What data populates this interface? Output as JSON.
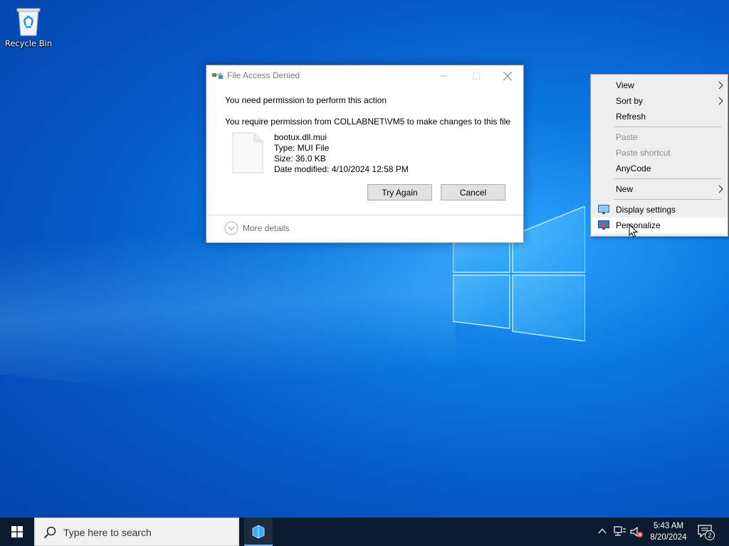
{
  "desktop": {
    "icons": [
      {
        "label": "Recycle Bin",
        "icon": "recycle-bin-icon"
      }
    ]
  },
  "dialog": {
    "title": "File Access Denied",
    "heading": "You need permission to perform this action",
    "message": "You require permission from COLLABNET\\VM5 to make changes to this file",
    "file": {
      "name": "bootux.dll.mui",
      "type": "Type: MUI File",
      "size": "Size: 36.0 KB",
      "modified": "Date modified: 4/10/2024 12:58 PM"
    },
    "buttons": {
      "try_again": "Try Again",
      "cancel": "Cancel"
    },
    "more_details": "More details"
  },
  "context_menu": {
    "items": [
      {
        "label": "View",
        "submenu": true,
        "enabled": true
      },
      {
        "label": "Sort by",
        "submenu": true,
        "enabled": true
      },
      {
        "label": "Refresh",
        "submenu": false,
        "enabled": true
      },
      {
        "label": "Paste",
        "submenu": false,
        "enabled": false
      },
      {
        "label": "Paste shortcut",
        "submenu": false,
        "enabled": false
      },
      {
        "label": "AnyCode",
        "submenu": false,
        "enabled": true
      },
      {
        "label": "New",
        "submenu": true,
        "enabled": true
      },
      {
        "label": "Display settings",
        "submenu": false,
        "enabled": true,
        "icon": "display-settings-icon"
      },
      {
        "label": "Personalize",
        "submenu": false,
        "enabled": true,
        "icon": "personalize-icon",
        "highlighted": true
      }
    ]
  },
  "taskbar": {
    "search_placeholder": "Type here to search",
    "clock": {
      "time": "5:43 AM",
      "date": "8/20/2024"
    },
    "notifications_count": "2"
  },
  "colors": {
    "taskbar": "#0b1a2e",
    "dialog_button": "#e1e1e1",
    "menu_bg": "#eeeeee"
  }
}
